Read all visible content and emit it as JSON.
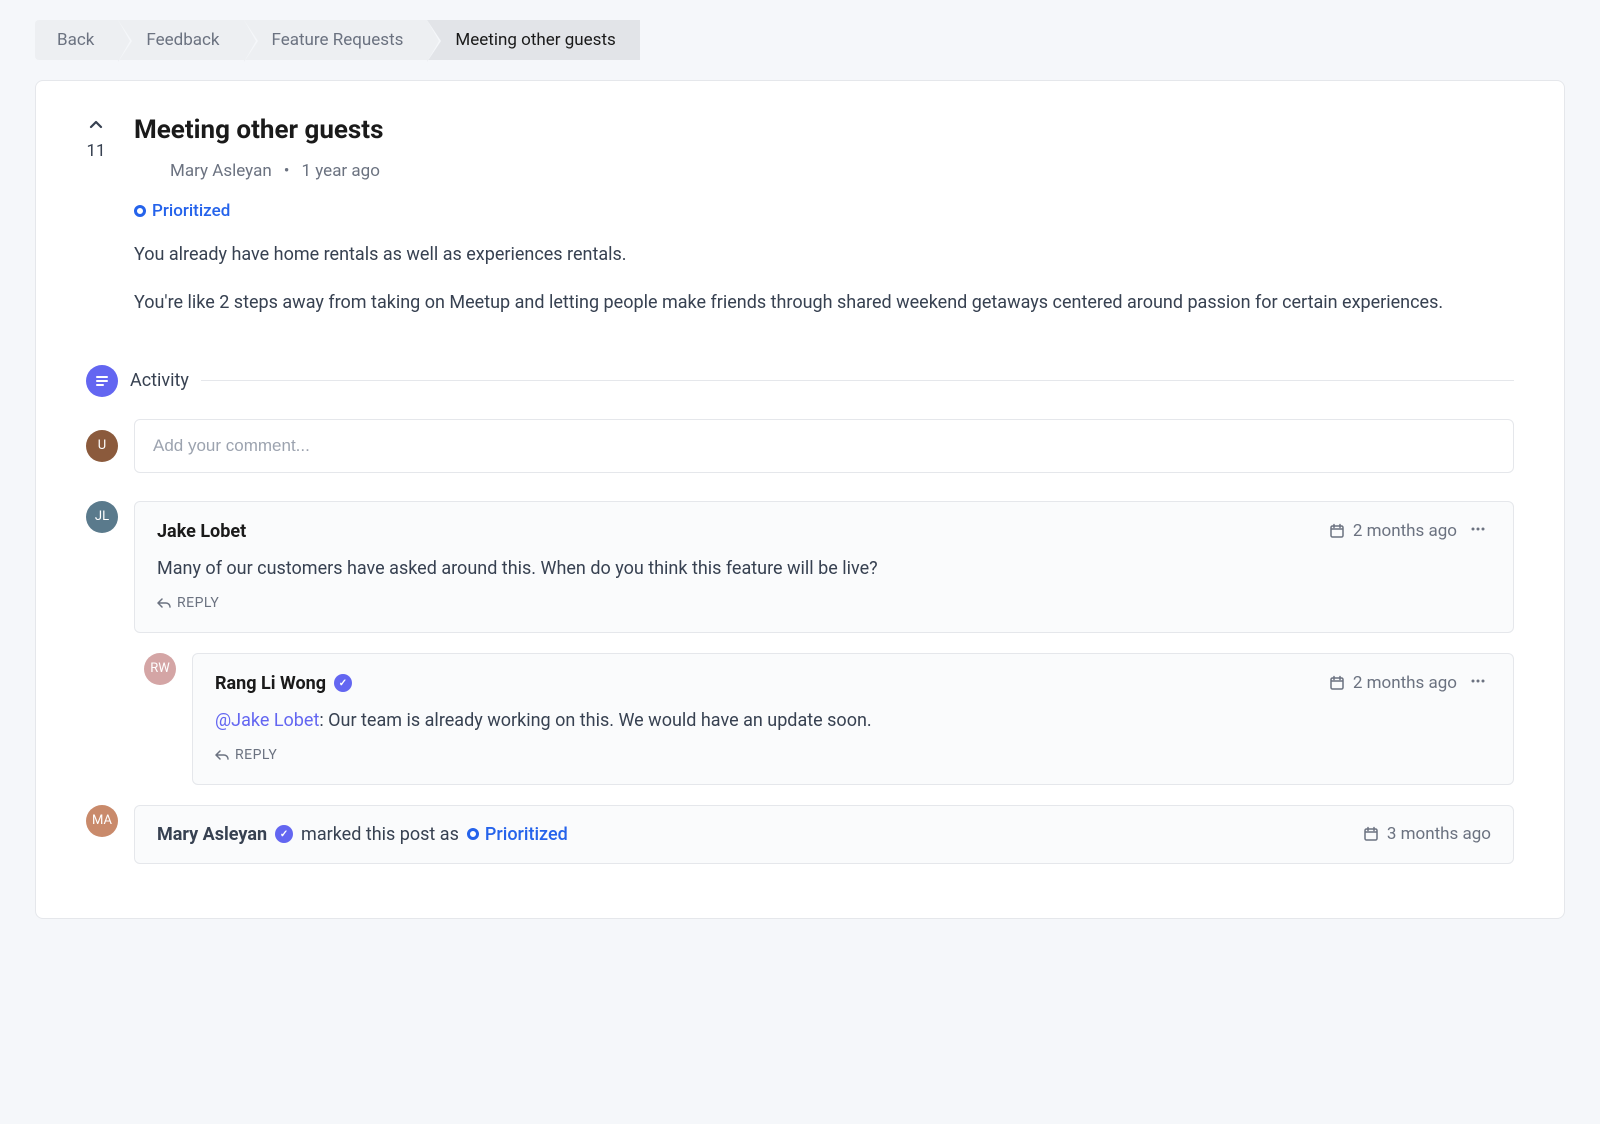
{
  "breadcrumb": {
    "items": [
      {
        "label": "Back"
      },
      {
        "label": "Feedback"
      },
      {
        "label": "Feature Requests"
      },
      {
        "label": "Meeting other guests"
      }
    ]
  },
  "post": {
    "title": "Meeting other guests",
    "vote_count": "11",
    "author": "Mary Asleyan",
    "author_avatar_bg": "#c98a6b",
    "time": "1 year ago",
    "status_label": "Prioritized",
    "body_p1": "You already have home rentals as well as experiences rentals.",
    "body_p2": "You're like 2 steps away from taking on Meetup and letting people make friends through shared weekend getaways centered around passion for certain experiences."
  },
  "activity": {
    "label": "Activity",
    "comment_placeholder": "Add your comment...",
    "current_user_avatar_bg": "#8b5a3c"
  },
  "comments": [
    {
      "author": "Jake Lobet",
      "avatar_bg": "#5a7a8c",
      "verified": false,
      "time": "2 months ago",
      "text": "Many of our customers have asked around this. When do you think this feature will be live?",
      "reply_label": "REPLY"
    },
    {
      "author": "Rang Li Wong",
      "avatar_bg": "#d4a5a5",
      "verified": true,
      "time": "2 months ago",
      "mention": "@Jake Lobet",
      "text": ": Our team is already working on this. We would have an update soon.",
      "reply_label": "REPLY"
    }
  ],
  "system_event": {
    "author": "Mary Asleyan",
    "avatar_bg": "#c98a6b",
    "verified": true,
    "action_text": "marked this post as",
    "status_label": "Prioritized",
    "time": "3 months ago"
  }
}
